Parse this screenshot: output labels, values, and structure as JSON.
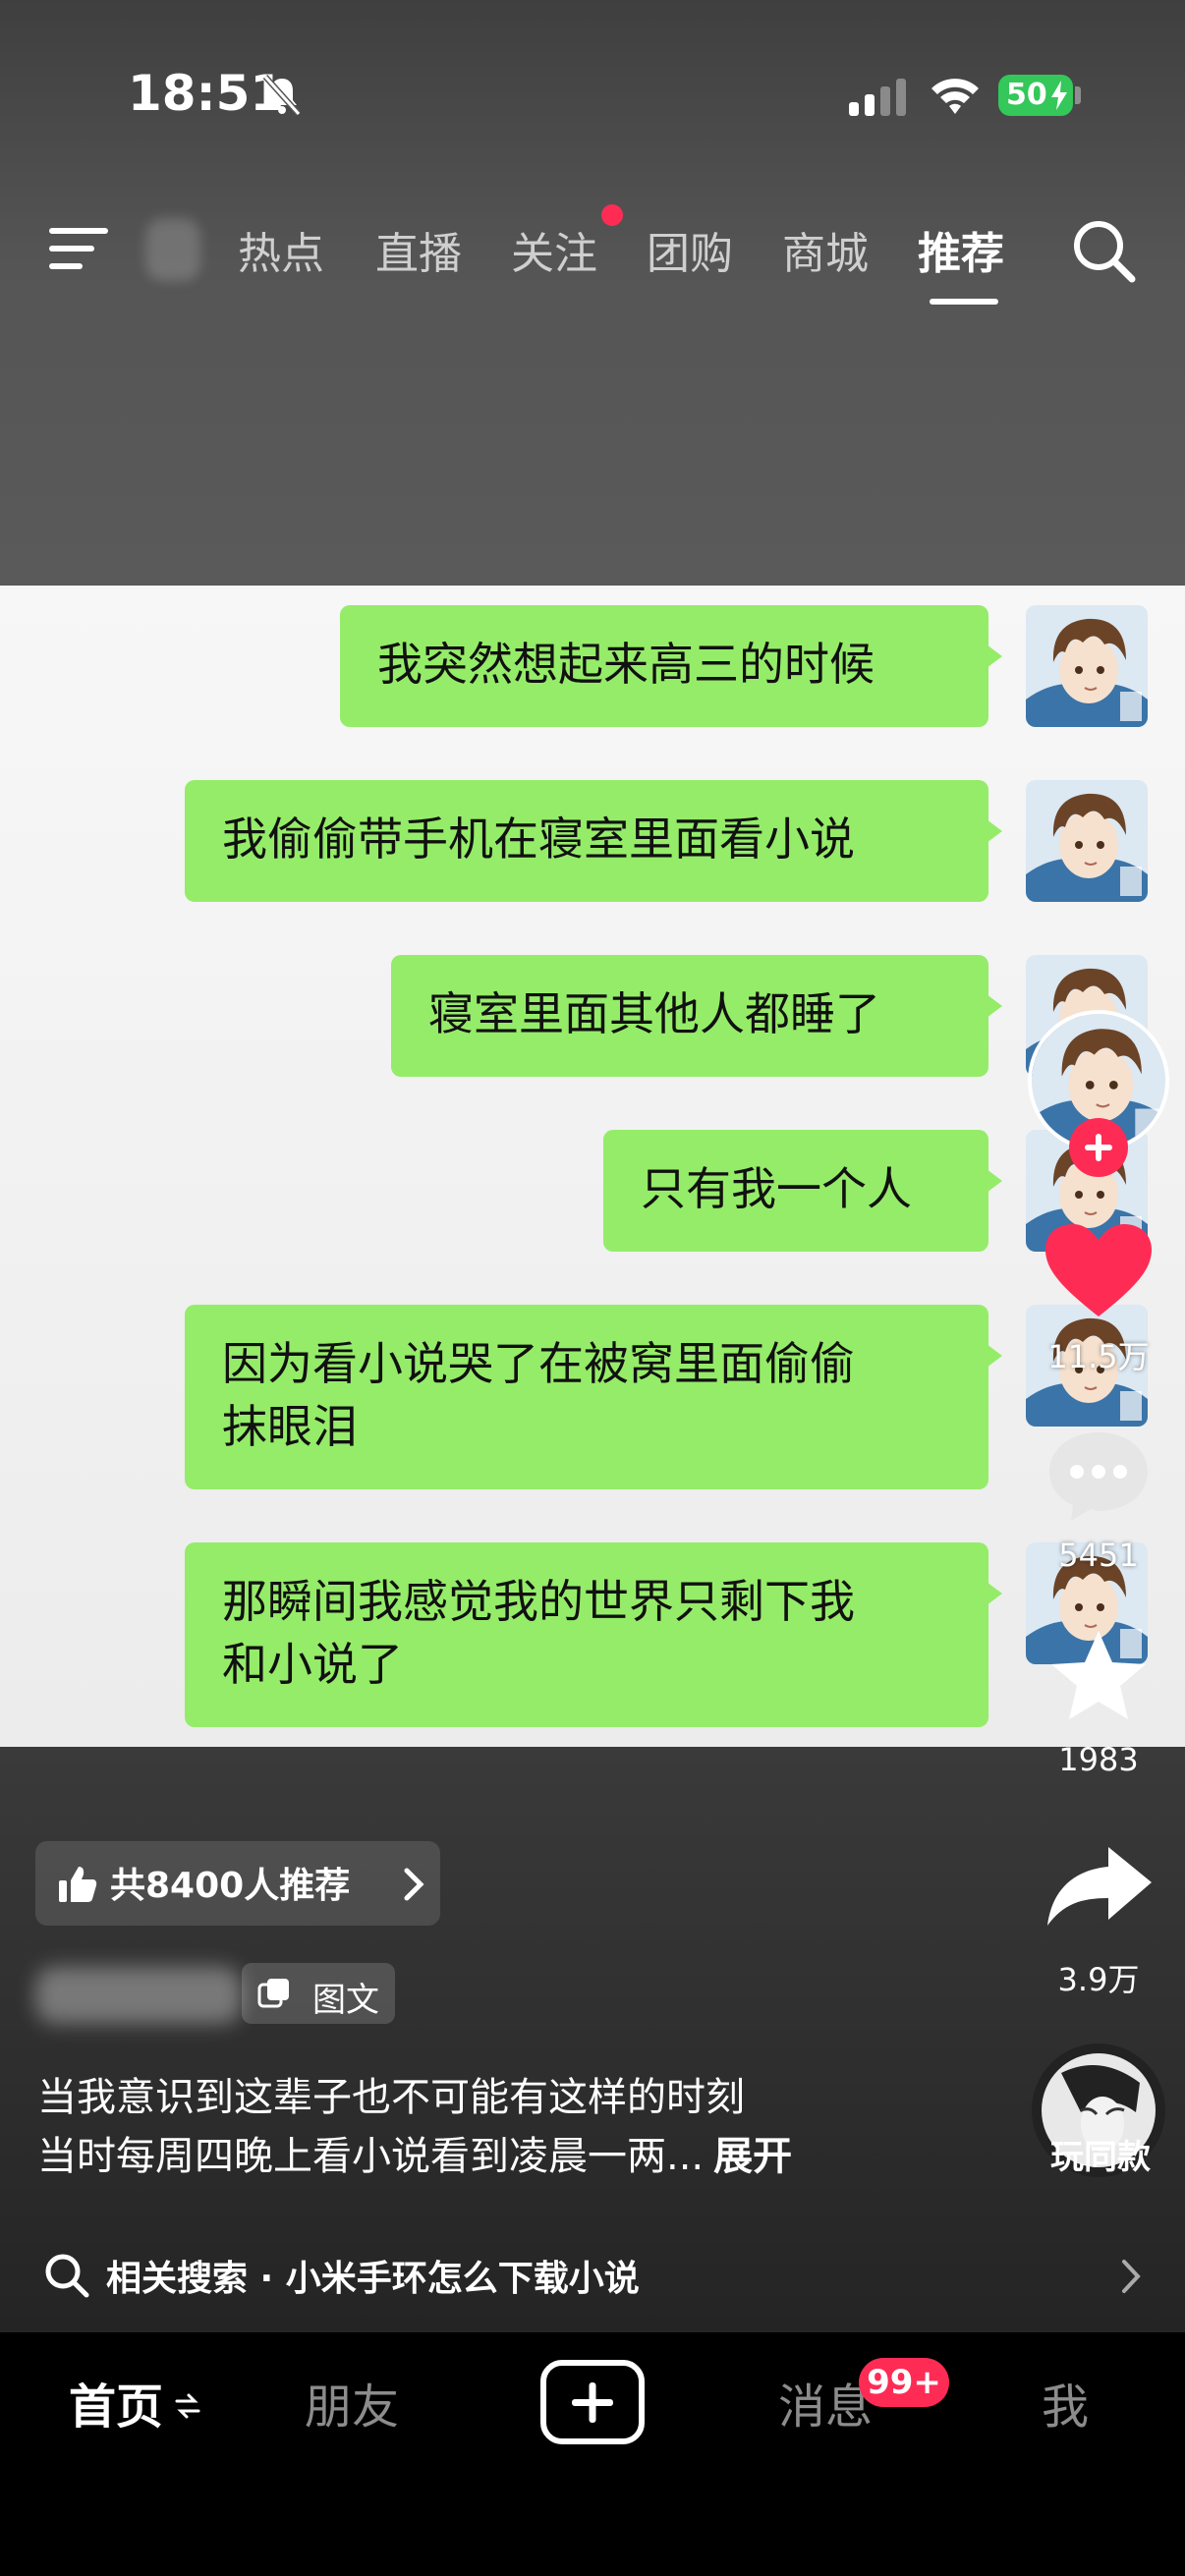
{
  "status_bar": {
    "time": "18:51",
    "battery": "50"
  },
  "nav": {
    "tabs": [
      {
        "label": "热点"
      },
      {
        "label": "直播"
      },
      {
        "label": "关注"
      },
      {
        "label": "团购"
      },
      {
        "label": "商城"
      },
      {
        "label": "推荐"
      }
    ],
    "active_tab": "推荐"
  },
  "chat": {
    "messages": [
      {
        "text": "我突然想起来高三的时候"
      },
      {
        "text": "我偷偷带手机在寝室里面看小说"
      },
      {
        "text": "寝室里面其他人都睡了"
      },
      {
        "text": "只有我一个人"
      },
      {
        "text_line1": "因为看小说哭了在被窝里面偷偷",
        "text_line2": "抹眼泪"
      },
      {
        "text_line1": "那瞬间我感觉我的世界只剩下我",
        "text_line2": "和小说了"
      }
    ]
  },
  "side_actions": {
    "likes": "11.5万",
    "comments": "5451",
    "favorites": "1983",
    "shares": "3.9万",
    "music_label": "玩同款"
  },
  "post": {
    "recommend_text": "共8400人推荐",
    "tuwen_label": "图文",
    "desc_line1": "当我意识到这辈子也不可能有这样的时刻",
    "desc_line2": "当时每周四晚上看小说看到凌晨一两...",
    "expand_label": "展开",
    "related_search": "相关搜索 · 小米手环怎么下载小说"
  },
  "tab_bar": {
    "home": "首页",
    "friends": "朋友",
    "messages": "消息",
    "messages_badge": "99+",
    "me": "我"
  },
  "colors": {
    "accent": "#fe2c55",
    "bubble": "#95ec69",
    "battery": "#34c759"
  }
}
